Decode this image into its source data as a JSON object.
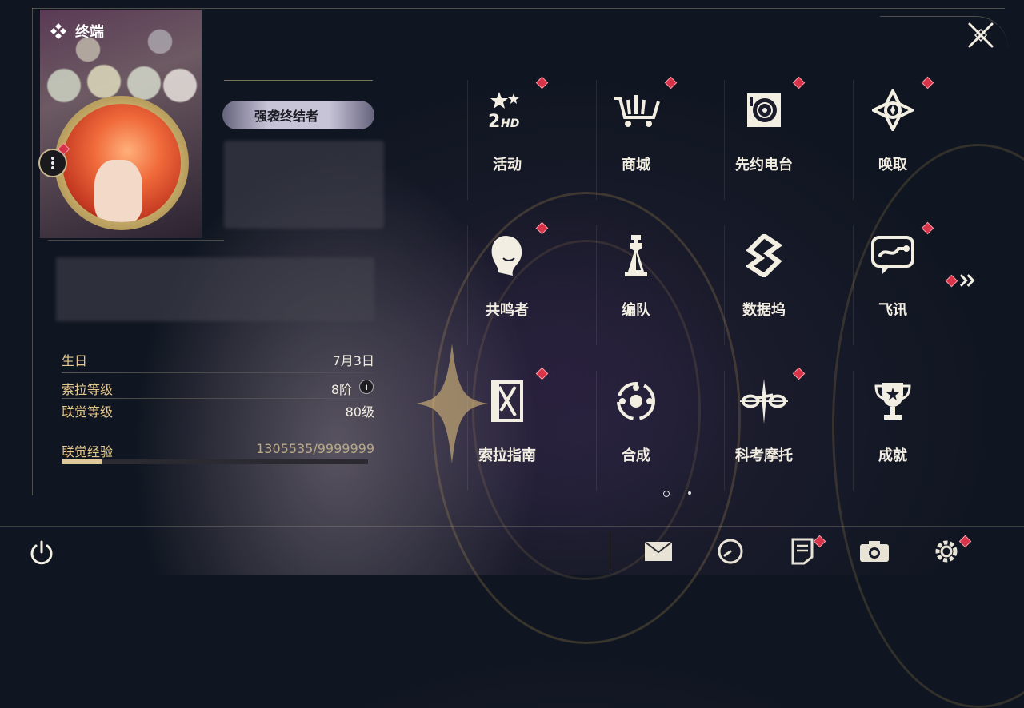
{
  "terminal": {
    "title": "终端"
  },
  "profile": {
    "title_badge": "强袭终结者"
  },
  "stats": {
    "birthday_label": "生日",
    "birthday_value": "7月3日",
    "sola_level_label": "索拉等级",
    "sola_level_value": "8阶",
    "union_level_label": "联觉等级",
    "union_level_value": "80级",
    "union_exp_label": "联觉经验",
    "union_exp_value": "1305535/9999999",
    "union_exp_fraction": 0.13
  },
  "menu": {
    "items": [
      {
        "label": "活动",
        "icon": "event-2hd-icon",
        "badge": true
      },
      {
        "label": "商城",
        "icon": "shop-cart-icon",
        "badge": true
      },
      {
        "label": "先约电台",
        "icon": "radio-record-icon",
        "badge": true
      },
      {
        "label": "唤取",
        "icon": "convene-star-icon",
        "badge": true
      },
      {
        "label": "共鸣者",
        "icon": "resonator-head-icon",
        "badge": true
      },
      {
        "label": "编队",
        "icon": "team-chess-icon",
        "badge": false
      },
      {
        "label": "数据坞",
        "icon": "data-bank-icon",
        "badge": false
      },
      {
        "label": "飞讯",
        "icon": "message-chat-icon",
        "badge": true
      },
      {
        "label": "索拉指南",
        "icon": "guide-book-icon",
        "badge": true
      },
      {
        "label": "合成",
        "icon": "synthesis-orbit-icon",
        "badge": false
      },
      {
        "label": "科考摩托",
        "icon": "motorcycle-icon",
        "badge": true
      },
      {
        "label": "成就",
        "icon": "trophy-icon",
        "badge": false
      }
    ],
    "page_current": 1,
    "page_total": 2
  },
  "bottom_bar": {
    "icons": [
      "mail-icon",
      "clock-icon",
      "notice-icon",
      "camera-icon",
      "settings-gear-icon"
    ]
  },
  "colors": {
    "accent_gold": "#e6c98d",
    "badge_red": "#d9334a",
    "text_light": "#f3eee2"
  }
}
